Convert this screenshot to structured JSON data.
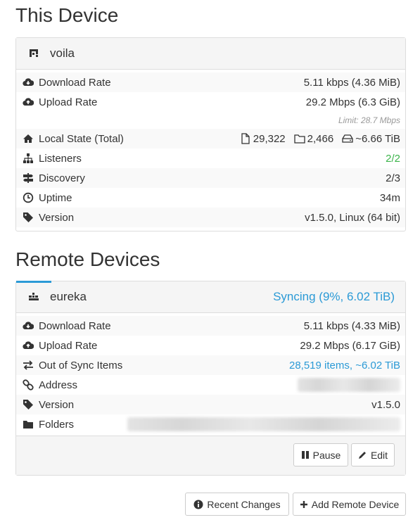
{
  "this_device": {
    "title": "This Device",
    "name": "voila",
    "rows": {
      "download_label": "Download Rate",
      "download_value": "5.11 kbps (4.36 MiB)",
      "upload_label": "Upload Rate",
      "upload_value": "29.2 Mbps (6.3 GiB)",
      "limit": "Limit: 28.7 Mbps",
      "state_label": "Local State (Total)",
      "state_files": "29,322",
      "state_dirs": "2,466",
      "state_size": "~6.66 TiB",
      "listeners_label": "Listeners",
      "listeners_value": "2/2",
      "discovery_label": "Discovery",
      "discovery_value": "2/3",
      "uptime_label": "Uptime",
      "uptime_value": "34m",
      "version_label": "Version",
      "version_value": "v1.5.0, Linux (64 bit)"
    }
  },
  "remote_devices": {
    "title": "Remote Devices",
    "device": {
      "name": "eureka",
      "status": "Syncing (9%, 6.02 TiB)",
      "progress_percent": 9,
      "rows": {
        "download_label": "Download Rate",
        "download_value": "5.11 kbps (4.33 MiB)",
        "upload_label": "Upload Rate",
        "upload_value": "29.2 Mbps (6.17 GiB)",
        "oos_label": "Out of Sync Items",
        "oos_value": "28,519 items, ~6.02 TiB",
        "address_label": "Address",
        "version_label": "Version",
        "version_value": "v1.5.0",
        "folders_label": "Folders"
      },
      "buttons": {
        "pause": "Pause",
        "edit": "Edit"
      }
    }
  },
  "footer_buttons": {
    "recent_changes": "Recent Changes",
    "add_remote_device": "Add Remote Device"
  },
  "colors": {
    "accent": "#2b9ad6",
    "success": "#3cb44b",
    "heading_bg": "#f5f5f5"
  }
}
